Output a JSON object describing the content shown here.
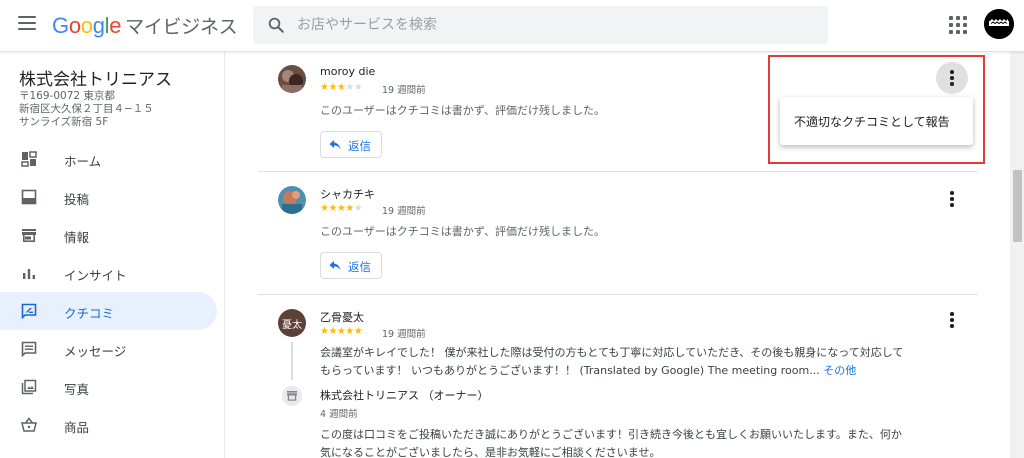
{
  "header": {
    "logo_g1": "G",
    "logo_g2": "o",
    "logo_g3": "o",
    "logo_g4": "g",
    "logo_g5": "l",
    "logo_g6": "e",
    "product": "マイビジネス",
    "search_placeholder": "お店やサービスを検索"
  },
  "sidebar": {
    "business_name": "株式会社トリニアス",
    "address_line1": "〒169-0072 東京都",
    "address_line2": "新宿区大久保２丁目４−１５",
    "address_line3": "サンライズ新宿 5F",
    "items": [
      {
        "label": "ホーム",
        "icon": "dashboard-icon"
      },
      {
        "label": "投稿",
        "icon": "post-icon"
      },
      {
        "label": "情報",
        "icon": "storefront-icon"
      },
      {
        "label": "インサイト",
        "icon": "insights-icon"
      },
      {
        "label": "クチコミ",
        "icon": "reviews-icon",
        "active": true
      },
      {
        "label": "メッセージ",
        "icon": "message-icon"
      },
      {
        "label": "写真",
        "icon": "photo-icon"
      },
      {
        "label": "商品",
        "icon": "basket-icon"
      }
    ]
  },
  "reviews": [
    {
      "name": "moroy die",
      "stars": 3,
      "time": "19 週間前",
      "text": "このユーザーはクチコミは書かず、評価だけ残しました。",
      "reply_label": "返信"
    },
    {
      "name": "シャカチキ",
      "stars": 4,
      "time": "19 週間前",
      "text": "このユーザーはクチコミは書かず、評価だけ残しました。",
      "reply_label": "返信"
    },
    {
      "name": "乙骨憂太",
      "avatar_text": "憂太",
      "stars": 5,
      "time": "19 週間前",
      "text_line1": "会議室がキレイでした！ 僕が来社した際は受付の方もとても丁寧に対応していただき、その後も親身になって対応して",
      "text_line2": "もらっています！ いつもありがとうございます！！ (Translated by Google) The meeting room...",
      "more_label": "その他",
      "owner_name": "株式会社トリニアス （オーナー）",
      "owner_time": "4 週間前",
      "owner_reply_line1": "この度は口コミをご投稿いただき誠にありがとうございます！引き続き今後とも宜しくお願いいたします。また、何か",
      "owner_reply_line2": "気になることがございましたら、是非お気軽にご相談くださいませ。"
    }
  ],
  "popup_menu": {
    "report_label": "不適切なクチコミとして報告"
  },
  "colors": {
    "accent": "#1a73e8",
    "active_bg": "#e8f0fe",
    "star": "#fbbc04",
    "highlight": "#e53935"
  }
}
